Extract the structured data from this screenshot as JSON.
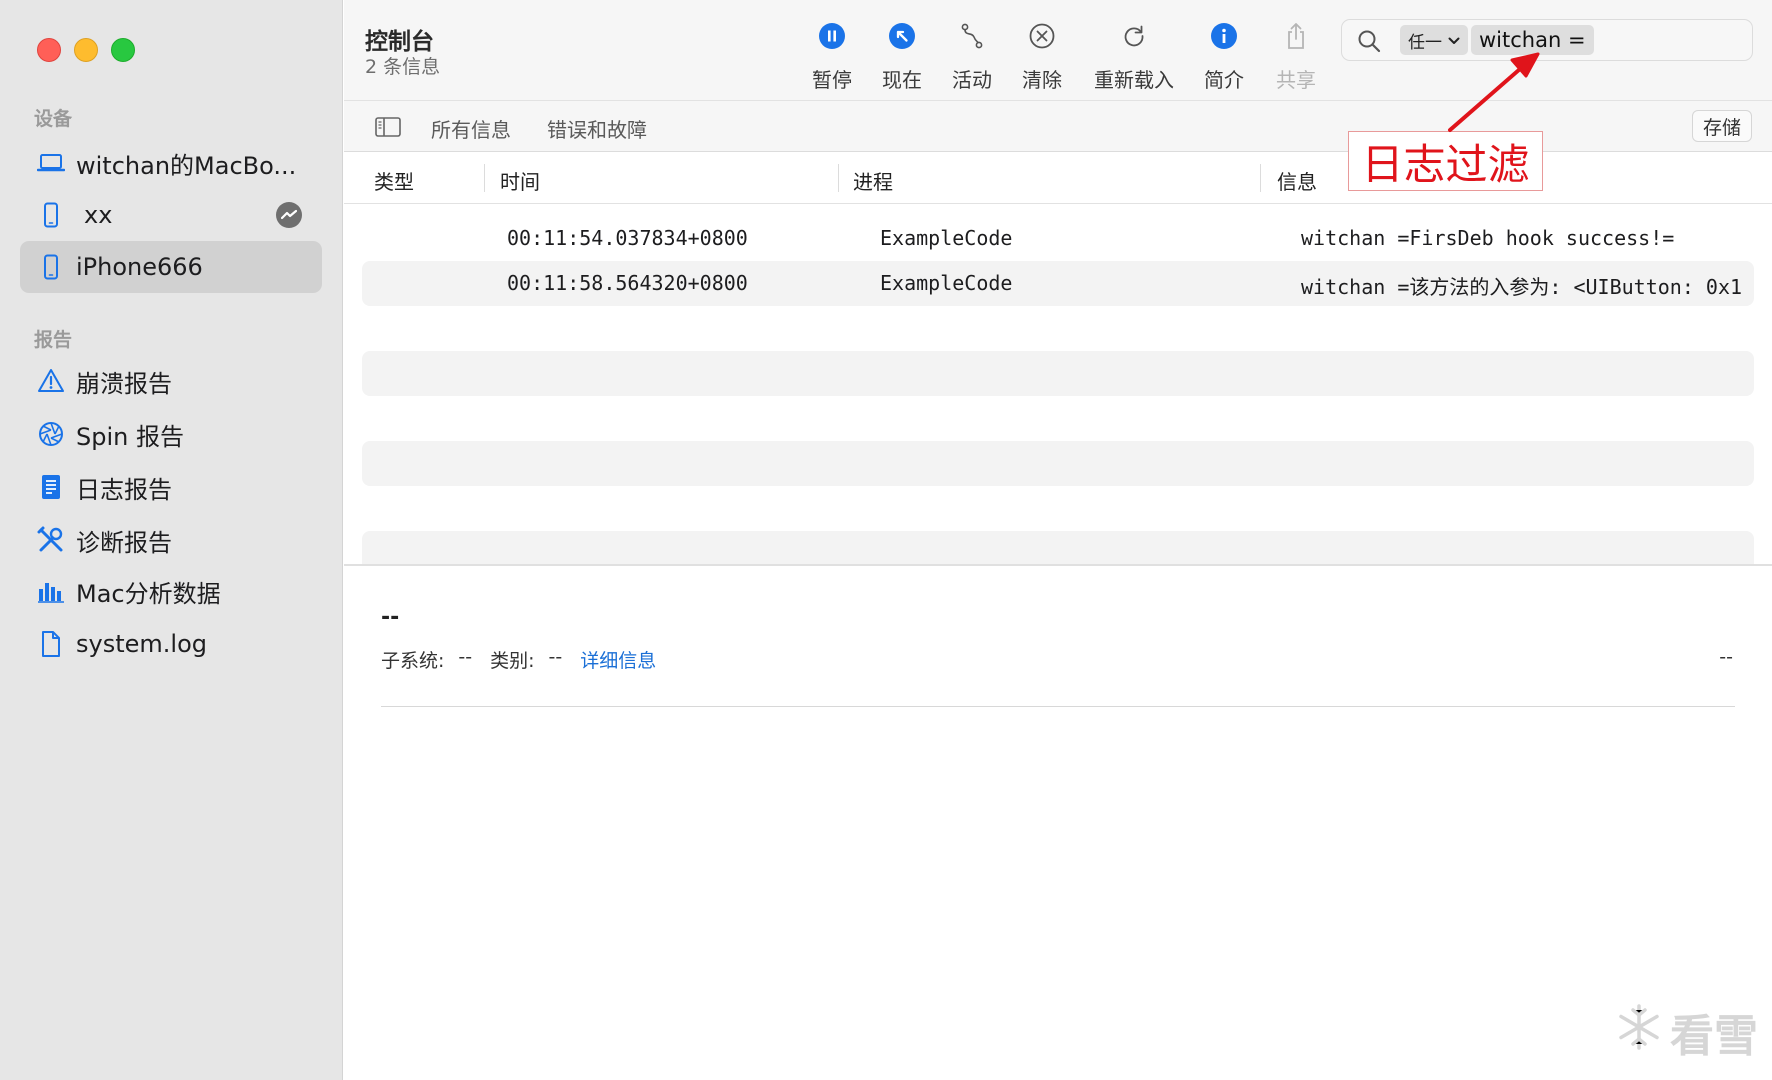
{
  "sidebar": {
    "devices_title": "设备",
    "devices": [
      {
        "label": "witchan的MacBo...",
        "icon": "laptop-icon"
      },
      {
        "label": "xx",
        "icon": "iphone-icon",
        "badge": "messenger-icon"
      },
      {
        "label": "iPhone666",
        "icon": "iphone-icon",
        "selected": true
      }
    ],
    "reports_title": "报告",
    "reports": [
      {
        "label": "崩溃报告",
        "icon": "warning-icon"
      },
      {
        "label": "Spin 报告",
        "icon": "aperture-icon"
      },
      {
        "label": "日志报告",
        "icon": "document-icon"
      },
      {
        "label": "诊断报告",
        "icon": "tools-icon"
      },
      {
        "label": "Mac分析数据",
        "icon": "bar-chart-icon"
      },
      {
        "label": "system.log",
        "icon": "file-icon"
      }
    ]
  },
  "toolbar": {
    "title": "控制台",
    "subtitle": "2 条信息",
    "buttons": [
      {
        "label": "暂停",
        "icon": "pause-icon"
      },
      {
        "label": "现在",
        "icon": "jump-now-icon"
      },
      {
        "label": "活动",
        "icon": "activity-icon"
      },
      {
        "label": "清除",
        "icon": "clear-icon"
      },
      {
        "label": "重新载入",
        "icon": "reload-icon"
      },
      {
        "label": "简介",
        "icon": "info-icon"
      },
      {
        "label": "共享",
        "icon": "share-icon",
        "disabled": true
      }
    ],
    "search": {
      "scope": "任一",
      "token": "witchan ="
    }
  },
  "filterbar": {
    "tabs": [
      "所有信息",
      "错误和故障"
    ],
    "save_label": "存储"
  },
  "columns": [
    "类型",
    "时间",
    "进程",
    "信息"
  ],
  "rows": [
    {
      "type": "",
      "time": "00:11:54.037834+0800",
      "process": "ExampleCode",
      "message": "witchan =FirsDeb hook success!="
    },
    {
      "type": "",
      "time": "00:11:58.564320+0800",
      "process": "ExampleCode",
      "message": "witchan =该方法的入参为: <UIButton: 0x1"
    }
  ],
  "detail": {
    "title": "--",
    "subsystem_label": "子系统:",
    "subsystem_value": "--",
    "category_label": "类别:",
    "category_value": "--",
    "link": "详细信息",
    "right_value": "--"
  },
  "annotation": {
    "text": "日志过滤",
    "color": "#e0141b"
  },
  "watermark": "看雪",
  "colors": {
    "accent": "#1a73e8",
    "close": "#ff5f57",
    "minimize": "#febc2e",
    "zoom": "#28c840"
  }
}
